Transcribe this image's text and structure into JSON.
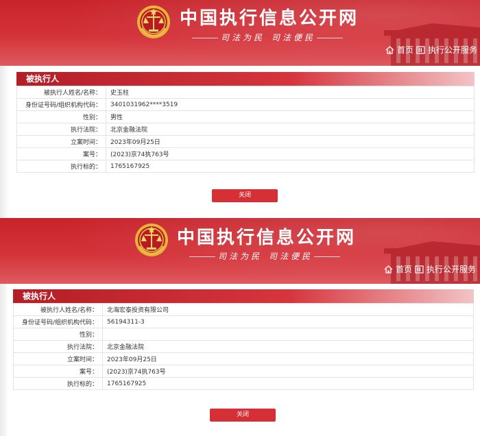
{
  "site": {
    "title": "中国执行信息公开网",
    "slogan_left": "司法为民",
    "slogan_right": "司法便民",
    "nav_home": "首页",
    "nav_service": "执行公开服务"
  },
  "records": [
    {
      "section_title": "被执行人",
      "rows": [
        {
          "label": "被执行人姓名/名称：",
          "value": "史玉柱"
        },
        {
          "label": "身份证号码/组织机构代码：",
          "value": "3401031962****3519"
        },
        {
          "label": "性别：",
          "value": "男性"
        },
        {
          "label": "执行法院：",
          "value": "北京金融法院"
        },
        {
          "label": "立案时间：",
          "value": "2023年09月25日"
        },
        {
          "label": "案号：",
          "value": "(2023)京74执763号"
        },
        {
          "label": "执行标的：",
          "value": "1765167925"
        }
      ],
      "close_label": "关闭"
    },
    {
      "section_title": "被执行人",
      "rows": [
        {
          "label": "被执行人姓名/名称：",
          "value": "北海宏泰投资有限公司"
        },
        {
          "label": "身份证号码/组织机构代码：",
          "value": "56194311-3"
        },
        {
          "label": "性别：",
          "value": ""
        },
        {
          "label": "执行法院：",
          "value": "北京金融法院"
        },
        {
          "label": "立案时间：",
          "value": "2023年09月25日"
        },
        {
          "label": "案号：",
          "value": "(2023)京74执763号"
        },
        {
          "label": "执行标的：",
          "value": "1765167925"
        }
      ],
      "close_label": "关闭"
    }
  ],
  "colors": {
    "brand_red": "#c8232b",
    "button_red": "#d62f36"
  }
}
